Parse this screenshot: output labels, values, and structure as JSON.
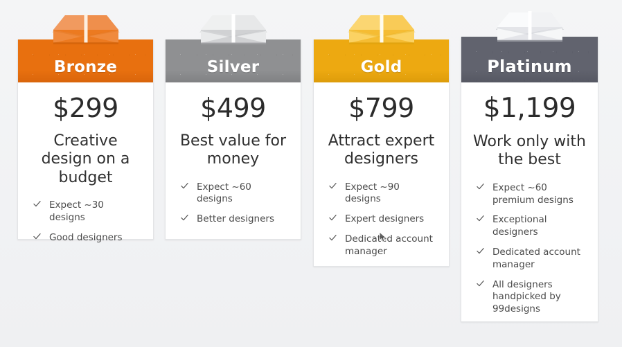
{
  "page": {
    "background_color": "#f2f3f5",
    "card_background": "#ffffff",
    "text_color": "#303030"
  },
  "plans": [
    {
      "id": "bronze",
      "name": "Bronze",
      "price": "$299",
      "tagline": "Creative design on a budget",
      "header_color": "#e8700f",
      "header_color_dark": "#d9650b",
      "box_top_color": "#f08a3c",
      "box_front_color": "#ec7a20",
      "box_side_color": "#d9650b",
      "features": [
        "Expect ~30 designs",
        "Good designers"
      ]
    },
    {
      "id": "silver",
      "name": "Silver",
      "price": "$499",
      "tagline": "Best value for money",
      "header_color": "#8f9092",
      "header_color_dark": "#808183",
      "box_top_color": "#eceded",
      "box_front_color": "#d8d9da",
      "box_side_color": "#c3c4c6",
      "features": [
        "Expect ~60 designs",
        "Better designers"
      ]
    },
    {
      "id": "gold",
      "name": "Gold",
      "price": "$799",
      "tagline": "Attract expert designers",
      "header_color": "#eda911",
      "header_color_dark": "#dd9c0a",
      "box_top_color": "#fbd05e",
      "box_front_color": "#f7c139",
      "box_side_color": "#e0a81c",
      "features": [
        "Expect ~90 designs",
        "Expert designers",
        "Dedicated account manager"
      ]
    },
    {
      "id": "platinum",
      "name": "Platinum",
      "price": "$1,199",
      "tagline": "Work only with the best",
      "header_color": "#61636e",
      "header_color_dark": "#565863",
      "box_top_color": "#fbfbfc",
      "box_front_color": "#eeeff1",
      "box_side_color": "#dcdde0",
      "features": [
        "Expect ~60 premium designs",
        "Exceptional designers",
        "Dedicated account manager",
        "All designers handpicked by 99designs"
      ]
    }
  ],
  "icons": {
    "package": "package-box-icon",
    "check": "check-icon",
    "cursor": "mouse-cursor-icon"
  }
}
